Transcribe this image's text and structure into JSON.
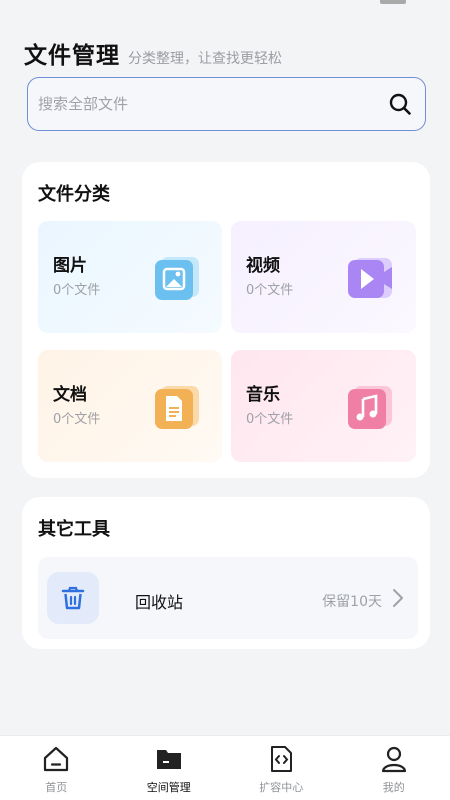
{
  "header": {
    "title": "文件管理",
    "subtitle": "分类整理，让查找更轻松"
  },
  "search": {
    "placeholder": "搜索全部文件",
    "icon": "search-icon"
  },
  "categories": {
    "title": "文件分类",
    "items": [
      {
        "label": "图片",
        "count": "0个文件",
        "icon": "image-icon",
        "color": "#6cc0ef"
      },
      {
        "label": "视频",
        "count": "0个文件",
        "icon": "video-icon",
        "color": "#a986f3"
      },
      {
        "label": "文档",
        "count": "0个文件",
        "icon": "document-icon",
        "color": "#f2b155"
      },
      {
        "label": "音乐",
        "count": "0个文件",
        "icon": "music-icon",
        "color": "#f07fa6"
      }
    ]
  },
  "tools": {
    "title": "其它工具",
    "items": [
      {
        "label": "回收站",
        "hint": "保留10天",
        "icon": "trash-icon",
        "color": "#2f6fe0"
      }
    ]
  },
  "tabbar": {
    "items": [
      {
        "label": "首页",
        "icon": "home-icon",
        "active": false
      },
      {
        "label": "空间管理",
        "icon": "folder-icon",
        "active": true
      },
      {
        "label": "扩容中心",
        "icon": "code-file-icon",
        "active": false
      },
      {
        "label": "我的",
        "icon": "user-icon",
        "active": false
      }
    ]
  }
}
